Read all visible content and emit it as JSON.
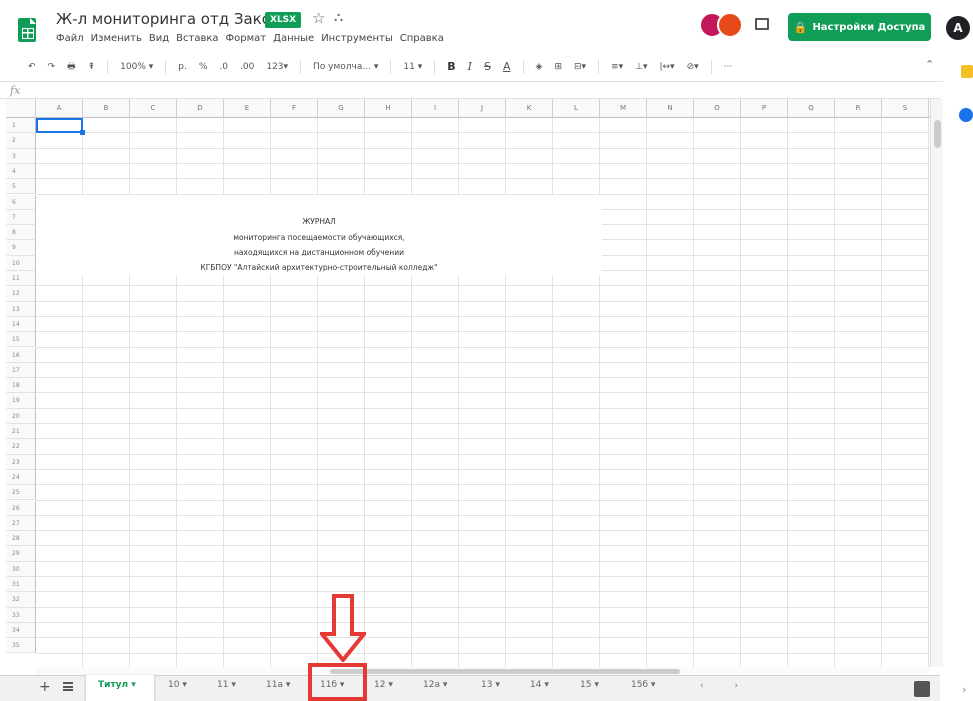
{
  "header": {
    "title": "Ж-л мониторинга отд Закопко",
    "file_badge": "XLSX",
    "star_glyph": "☆",
    "folder_glyph": "⛬",
    "menu": [
      "Файл",
      "Изменить",
      "Вид",
      "Вставка",
      "Формат",
      "Данные",
      "Инструменты",
      "Справка"
    ],
    "share_label": "Настройки Доступа",
    "account_initial": "A"
  },
  "toolbar": {
    "undo": "↶",
    "redo": "↷",
    "print": "🖶",
    "paint_format": "⇞",
    "zoom": "100%",
    "zoom_caret": "▾",
    "currency": "р.",
    "percent": "%",
    "dec_decrease": ".0",
    "dec_increase": ".00",
    "more_formats": "123▾",
    "font": "По умолча...",
    "font_caret": "▾",
    "font_size": "11",
    "font_size_caret": "▾",
    "bold": "B",
    "italic": "I",
    "strike": "S",
    "text_color": "A",
    "fill": "◈",
    "borders": "⊞",
    "merge": "⊟▾",
    "halign": "≡▾",
    "valign": "⊥▾",
    "wrap": "|↔▾",
    "rotate": "⊘▾",
    "more": "···",
    "collapse": "⌃"
  },
  "formula_bar": {
    "fx": "fx"
  },
  "sheet": {
    "columns": [
      "A",
      "B",
      "C",
      "D",
      "E",
      "F",
      "G",
      "H",
      "I",
      "J",
      "K",
      "L",
      "M",
      "N",
      "O",
      "P",
      "Q",
      "R",
      "S"
    ],
    "rows": [
      "1",
      "2",
      "3",
      "4",
      "5",
      "6",
      "7",
      "8",
      "9",
      "10",
      "11",
      "12",
      "13",
      "14",
      "15",
      "16",
      "17",
      "18",
      "19",
      "20",
      "21",
      "22",
      "23",
      "24",
      "25",
      "26",
      "27",
      "28",
      "29",
      "30",
      "31",
      "32",
      "33",
      "34",
      "35"
    ],
    "journal_title": "ЖУРНАЛ",
    "journal_line1": "мониторинга посещаемости обучающихся,",
    "journal_line2": "находящихся на дистанционном обучении",
    "journal_line3": "КГБПОУ \"Алтайский архитектурно-строительный колледж\""
  },
  "tabs": {
    "add": "+",
    "items": [
      {
        "label": "Титул ▾",
        "active": true
      },
      {
        "label": "10 ▾"
      },
      {
        "label": "11 ▾"
      },
      {
        "label": "11а ▾"
      },
      {
        "label": "11б ▾"
      },
      {
        "label": "12 ▾"
      },
      {
        "label": "12а ▾"
      },
      {
        "label": "13 ▾"
      },
      {
        "label": "14 ▾"
      },
      {
        "label": "15 ▾"
      },
      {
        "label": "15б ▾"
      }
    ],
    "nav": "‹ ›",
    "side_expand": "›"
  },
  "colors": {
    "brand_green": "#0f9d58",
    "selection_blue": "#1a73e8",
    "annotation_red": "#e53935"
  }
}
